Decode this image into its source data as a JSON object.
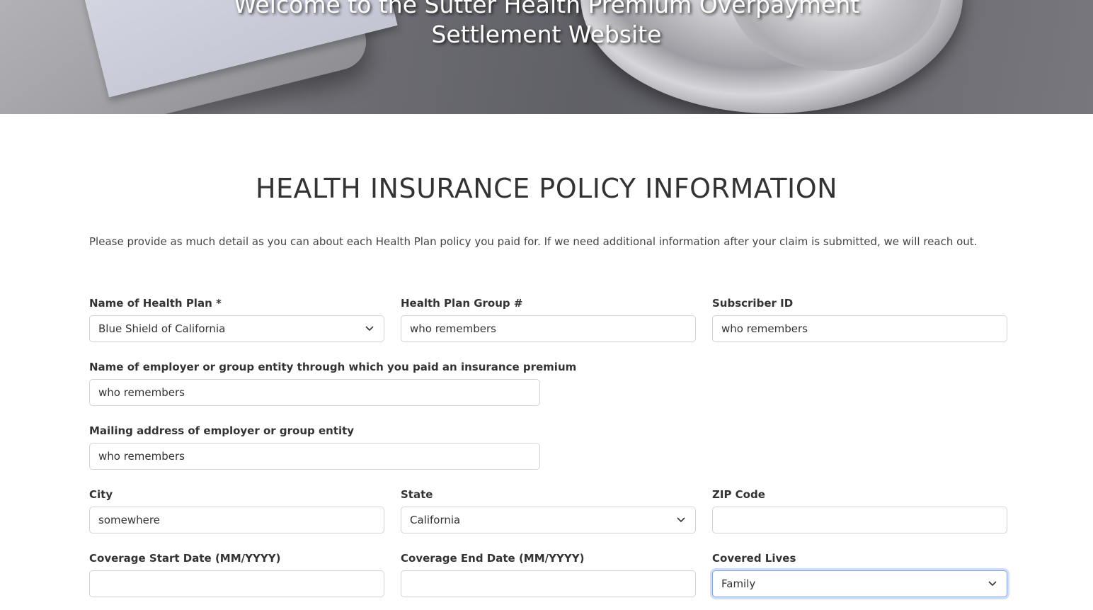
{
  "hero": {
    "title_line1": "Welcome to the Sutter Health Premium Overpayment",
    "title_line2": "Settlement Website"
  },
  "section": {
    "title": "HEALTH INSURANCE POLICY INFORMATION",
    "intro": "Please provide as much detail as you can about each Health Plan policy you paid for. If we need additional information after your claim is submitted, we will reach out."
  },
  "form": {
    "health_plan": {
      "label": "Name of Health Plan *",
      "value": "Blue Shield of California"
    },
    "group_number": {
      "label": "Health Plan Group #",
      "value": "who remembers"
    },
    "subscriber_id": {
      "label": "Subscriber ID",
      "value": "who remembers"
    },
    "employer_name": {
      "label": "Name of employer or group entity through which you paid an insurance premium",
      "value": "who remembers"
    },
    "employer_address": {
      "label": "Mailing address of employer or group entity",
      "value": "who remembers"
    },
    "city": {
      "label": "City",
      "value": "somewhere"
    },
    "state": {
      "label": "State",
      "value": "California"
    },
    "zip": {
      "label": "ZIP Code",
      "value": ""
    },
    "coverage_start": {
      "label": "Coverage Start Date (MM/YYYY)",
      "value": ""
    },
    "coverage_end": {
      "label": "Coverage End Date (MM/YYYY)",
      "value": ""
    },
    "covered_lives": {
      "label": "Covered Lives",
      "value": "Family"
    }
  },
  "icons": {
    "select_chevron": "chevron-down-icon"
  },
  "colors": {
    "focus_ring": "#86a8e0",
    "input_border": "#cfd4d9",
    "text": "#333333"
  }
}
